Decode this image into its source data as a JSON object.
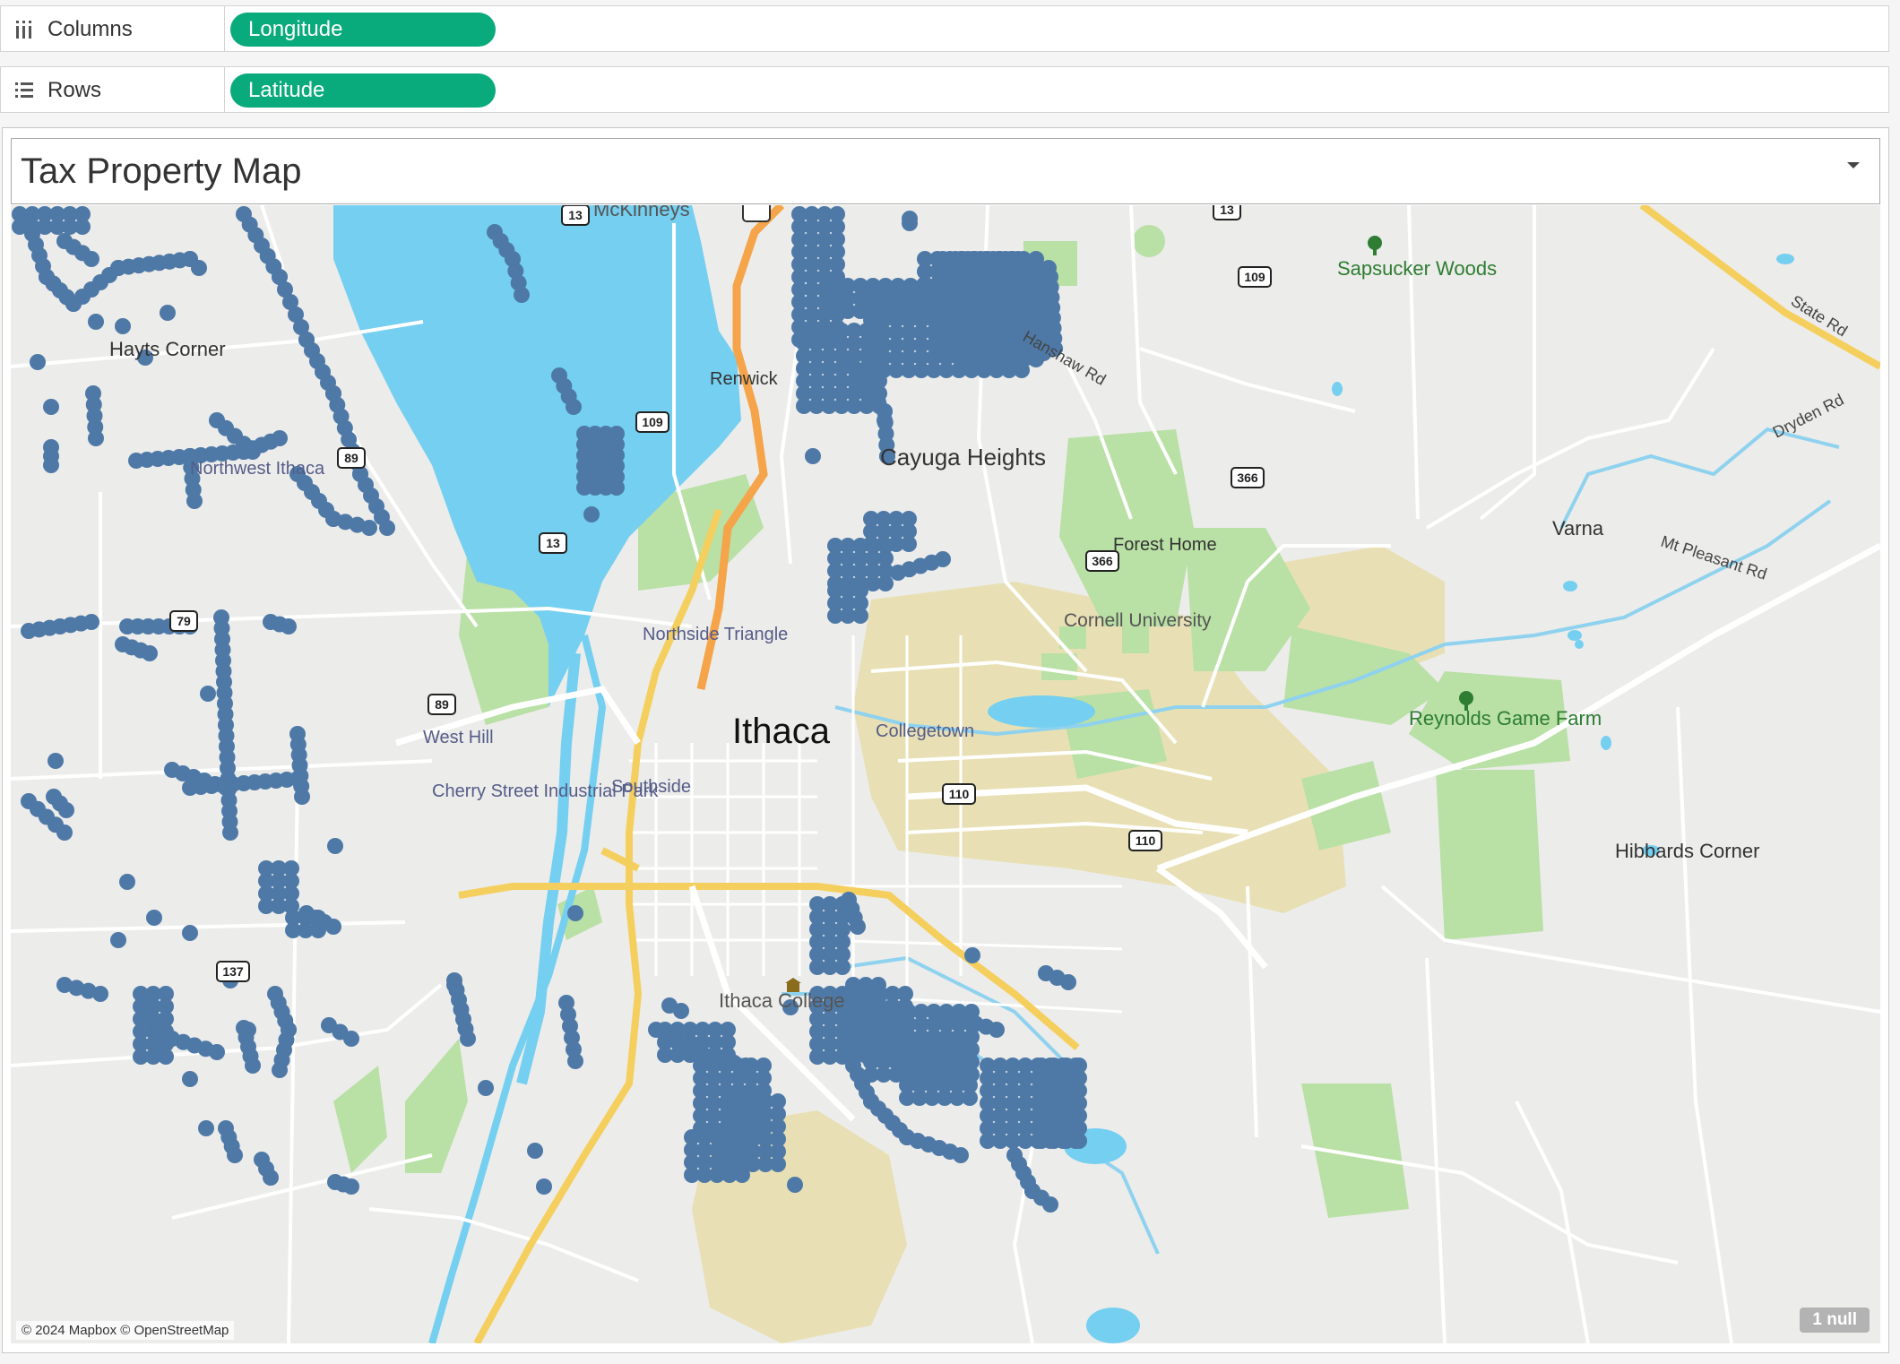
{
  "shelves": {
    "columns": {
      "label": "Columns",
      "icon": "columns-icon",
      "pill": "Longitude"
    },
    "rows": {
      "label": "Rows",
      "icon": "rows-icon",
      "pill": "Latitude"
    }
  },
  "colors": {
    "pill": "#09aa7b",
    "marks": "#4e79a7",
    "water": "#75cff0",
    "park": "#b9e0a5",
    "campus": "#e8e0b4",
    "land": "#ececea",
    "highway_major": "#f5a44a",
    "highway_state": "#f5cf5e",
    "road": "#ffffff"
  },
  "view": {
    "title": "Tax Property Map",
    "attribution": "© 2024 Mapbox © OpenStreetMap",
    "null_indicator": "1 null"
  },
  "map": {
    "place_labels": [
      "McKinneys",
      "Sapsucker Woods",
      "Hayts Corner",
      "Renwick",
      "Cayuga Heights",
      "Northwest Ithaca",
      "Hanshaw Rd",
      "Dryden Rd",
      "Varna",
      "Forest Home",
      "Mt Pleasant Rd",
      "Cornell University",
      "Northside Triangle",
      "Ithaca",
      "Collegetown",
      "West Hill",
      "Cherry Street Industrial Park",
      "Southside",
      "Reynolds Game Farm",
      "Hibbards Corner",
      "Ithaca College",
      "State Rd"
    ],
    "route_shields": [
      "13",
      "13",
      "109",
      "89",
      "13",
      "366",
      "79",
      "89",
      "110",
      "366",
      "109",
      "110",
      "137"
    ]
  }
}
